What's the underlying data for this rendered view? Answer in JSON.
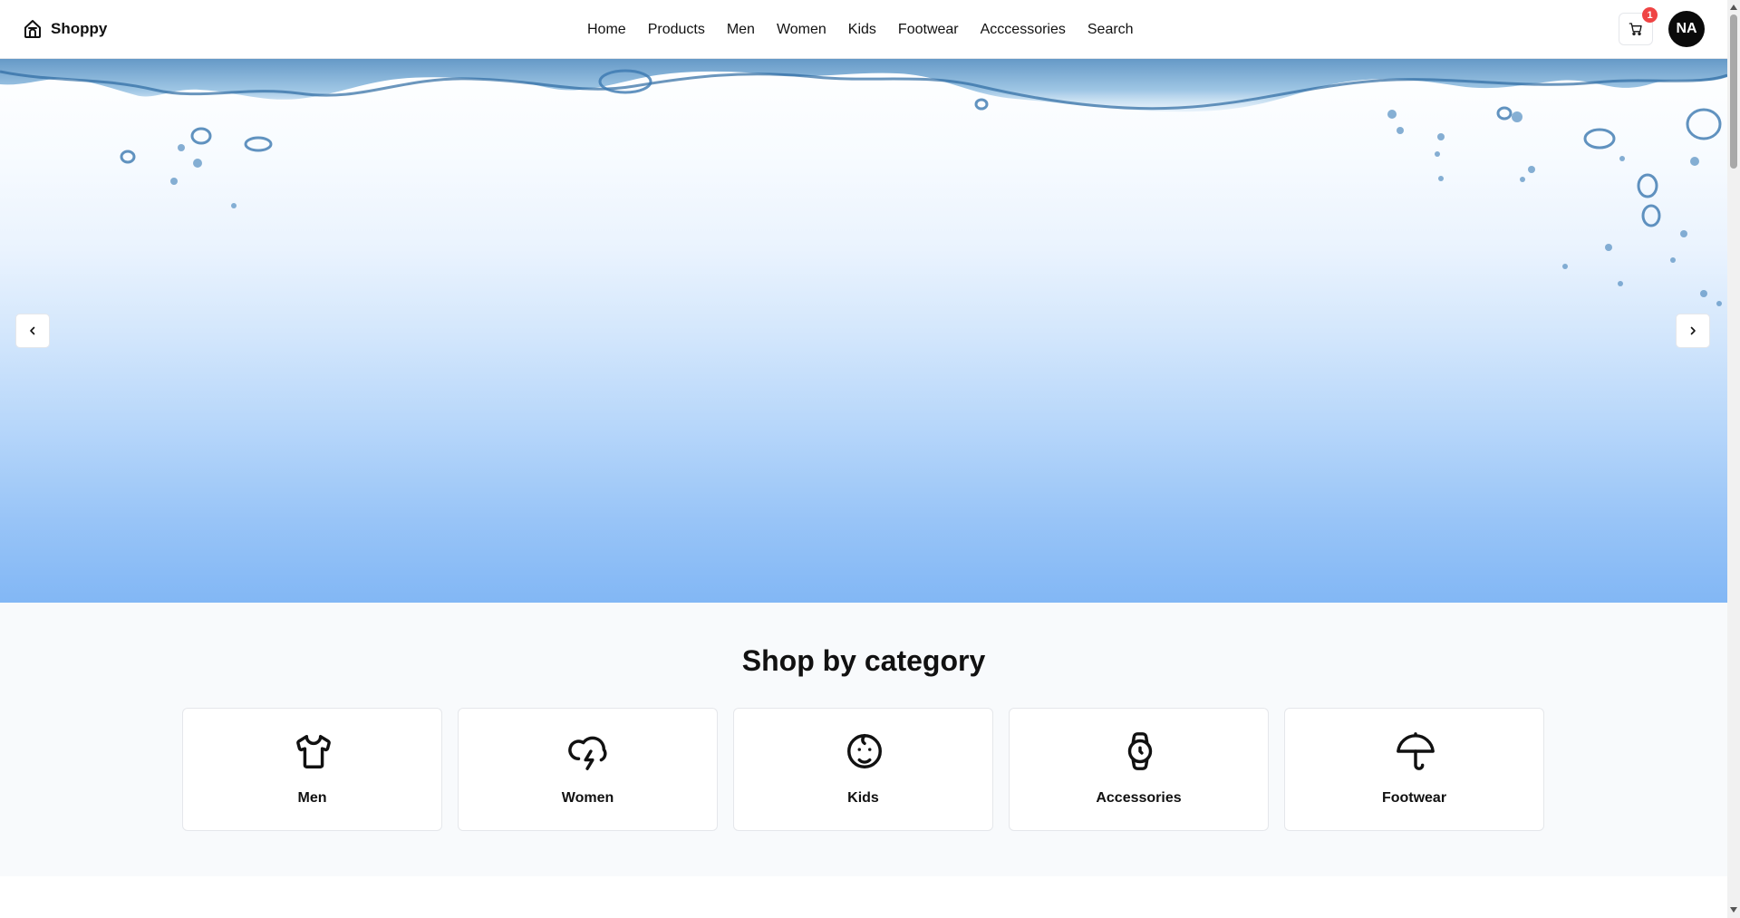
{
  "brand": {
    "name": "Shoppy",
    "icon": "store-icon"
  },
  "nav": [
    "Home",
    "Products",
    "Men",
    "Women",
    "Kids",
    "Footwear",
    "Acccessories",
    "Search"
  ],
  "cart": {
    "count": "1",
    "icon": "cart-icon"
  },
  "user": {
    "initials": "NA"
  },
  "hero": {
    "prev_icon": "chevron-left-icon",
    "next_icon": "chevron-right-icon"
  },
  "categories": {
    "title": "Shop by category",
    "items": [
      {
        "label": "Men",
        "icon": "shirt-icon"
      },
      {
        "label": "Women",
        "icon": "cloud-lightning-icon"
      },
      {
        "label": "Kids",
        "icon": "baby-icon"
      },
      {
        "label": "Accessories",
        "icon": "watch-icon"
      },
      {
        "label": "Footwear",
        "icon": "umbrella-icon"
      }
    ]
  },
  "colors": {
    "badge": "#ef4444",
    "avatar": "#0a0a0a",
    "section_bg": "#f8fafc"
  }
}
